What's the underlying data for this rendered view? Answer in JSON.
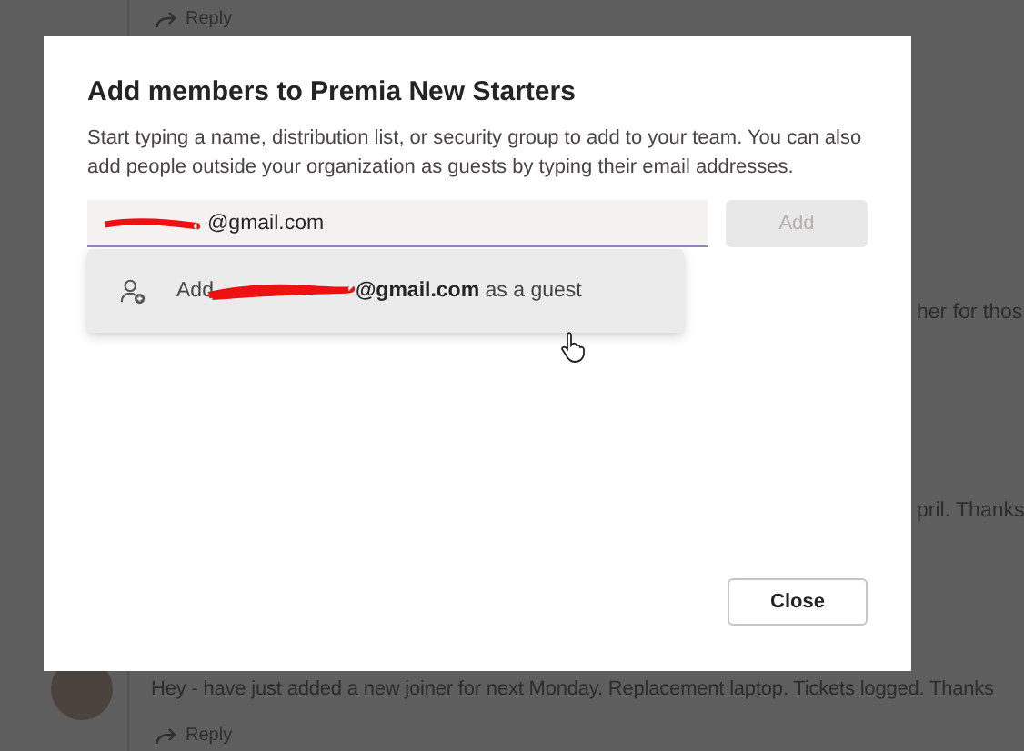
{
  "background": {
    "top_reply": "Reply",
    "snippets": [
      "her for thos",
      "pril. Thanks"
    ],
    "message": "Hey - have just added a new joiner for next Monday. Replacement laptop. Tickets logged. Thanks",
    "bottom_reply": "Reply"
  },
  "dialog": {
    "title": "Add members to Premia New Starters",
    "description": "Start typing a name, distribution list, or security group to add to your team. You can also add people outside your organization as guests by typing their email addresses.",
    "field": {
      "value": "@gmail.com"
    },
    "add_button": {
      "label": "Add",
      "disabled": true
    },
    "suggestion": {
      "prefix": "Add",
      "text": "**@gmail.com** as a guest"
    },
    "close_button": "Close"
  }
}
